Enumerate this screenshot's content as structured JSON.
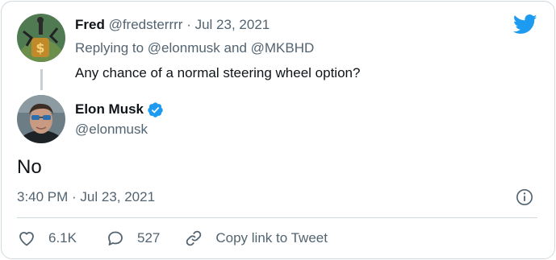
{
  "parent_tweet": {
    "display_name": "Fred",
    "handle": "@fredsterrrr",
    "separator": "·",
    "date": "Jul 23, 2021",
    "replying_prefix": "Replying to",
    "replying_to": "@elonmusk and @MKBHD",
    "text": "Any chance of a normal steering wheel option?"
  },
  "tweet": {
    "display_name": "Elon Musk",
    "handle": "@elonmusk",
    "verified": true,
    "text": "No",
    "timestamp": "3:40 PM · Jul 23, 2021"
  },
  "actions": {
    "like_count": "6.1K",
    "reply_count": "527",
    "copy_link_label": "Copy link to Tweet"
  },
  "icons": {
    "brand": "twitter-bird-icon",
    "verified": "verified-badge-icon",
    "info": "info-icon",
    "like": "heart-icon",
    "reply": "speech-bubble-icon",
    "link": "link-icon"
  },
  "colors": {
    "brand_blue": "#1d9bf0",
    "text_primary": "#0f1419",
    "text_secondary": "#536471",
    "border": "#cfd9de"
  }
}
